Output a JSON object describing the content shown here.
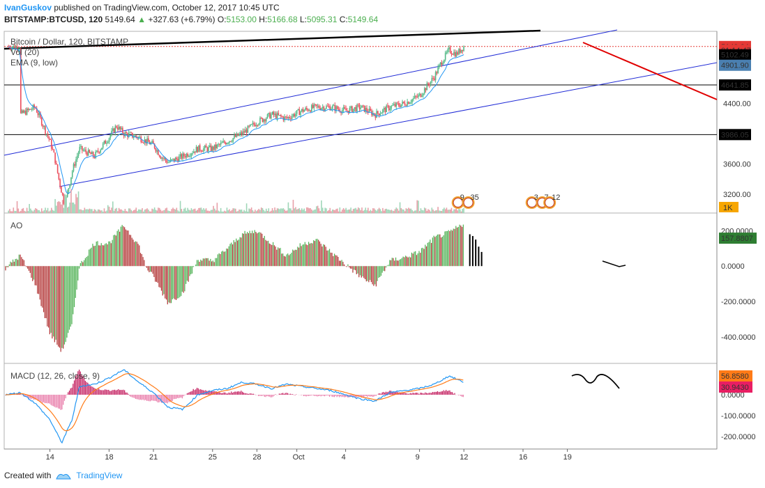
{
  "header": {
    "author": "IvanGuskov",
    "published": "published on TradingView.com, October 12, 2017 10:45 UTC",
    "symbol": "BITSTAMP:BTCUSD, 120",
    "price": "5149.64",
    "change": "+327.63 (+6.79%)",
    "o_label": "O:",
    "o": "5153.00",
    "h_label": "H:",
    "h": "5166.68",
    "l_label": "L:",
    "l": "5095.31",
    "c_label": "C:",
    "c": "5149.64"
  },
  "footer": {
    "created_with": "Created with",
    "brand": "TradingView"
  },
  "panes": {
    "main": {
      "legend": [
        "Bitcoin / Dollar, 120, BITSTAMP",
        "Vol (20)",
        "EMA (9, low)"
      ]
    },
    "ao": {
      "legend": "AO"
    },
    "macd": {
      "legend": "MACD (12, 26, close, 9)"
    }
  },
  "chart_data": [
    {
      "type": "candlestick",
      "title": "Bitcoin / Dollar, 120, BITSTAMP",
      "y_ticks": [
        "4400.00",
        "3600.00",
        "3200.00"
      ],
      "ylim": [
        2950,
        5350
      ],
      "x_ticks": [
        "14",
        "18",
        "21",
        "25",
        "28",
        "Oct",
        "4",
        "9",
        "12",
        "16",
        "19"
      ],
      "close_path_x_days": [
        12,
        13,
        14,
        14.3,
        14.6,
        15,
        15.5,
        16,
        17,
        18,
        18.5,
        19,
        20,
        21,
        21.5,
        22,
        23,
        24,
        25,
        26,
        27,
        28,
        29,
        30,
        31,
        32,
        33,
        34,
        35,
        36,
        37,
        38,
        39,
        40,
        40.5,
        41,
        41.5,
        42
      ],
      "close_path_y": [
        4250,
        4350,
        3900,
        3700,
        3400,
        3050,
        3500,
        3800,
        3700,
        3950,
        4100,
        4000,
        3950,
        3850,
        3700,
        3620,
        3700,
        3800,
        3800,
        3900,
        4000,
        4150,
        4250,
        4200,
        4300,
        4350,
        4350,
        4300,
        4350,
        4250,
        4350,
        4400,
        4500,
        4750,
        4950,
        5100,
        5050,
        5149.64
      ],
      "price_labels": [
        {
          "text": "5149.64",
          "value": 5149.64,
          "color": "#e53935"
        },
        {
          "text": "01:14:47",
          "value": 5100,
          "color": "#e53935"
        },
        {
          "text": "5102.49",
          "value": 5040,
          "color": "#000000"
        },
        {
          "text": "4901.90",
          "value": 4901.9,
          "color": "#4a7fb0"
        },
        {
          "text": "4641.85",
          "value": 4641.85,
          "color": "#000000"
        },
        {
          "text": "3986.05",
          "value": 3986.05,
          "color": "#000000"
        }
      ],
      "volume_label": "1K",
      "horizontal_levels": [
        4641.85,
        3986.05
      ],
      "colors": {
        "up": "#53b987",
        "down": "#eb4d5c",
        "ema": "#2196f3",
        "channel": "#1f2ad6",
        "forecast": "#e00000"
      }
    },
    {
      "type": "bar",
      "title": "AO",
      "y_ticks": [
        "200.0000",
        "0.0000",
        "-200.0000",
        "-400.0000"
      ],
      "ylim": [
        -550,
        300
      ],
      "current_label": "157.8807",
      "colors": {
        "up": "#4caf50",
        "down": "#b03030"
      }
    },
    {
      "type": "line",
      "title": "MACD (12, 26, close, 9)",
      "y_ticks": [
        "0.0000",
        "-100.0000",
        "-200.0000"
      ],
      "ylim": [
        -260,
        150
      ],
      "labels": [
        {
          "text": "56.8580",
          "color": "#ff7b17"
        },
        {
          "text": "30.9430",
          "color": "#e91e63"
        }
      ],
      "series": [
        {
          "name": "MACD",
          "color": "#2196f3"
        },
        {
          "name": "Signal",
          "color": "#ff7b17"
        }
      ]
    }
  ],
  "events": {
    "icons": [
      {
        "label": "9",
        "x_day": 41.6
      },
      {
        "label": "35",
        "x_day": 42.3
      },
      {
        "label": "3",
        "x_day": 46.6
      },
      {
        "label": "7",
        "x_day": 47.3
      },
      {
        "label": "12",
        "x_day": 47.8
      }
    ]
  }
}
